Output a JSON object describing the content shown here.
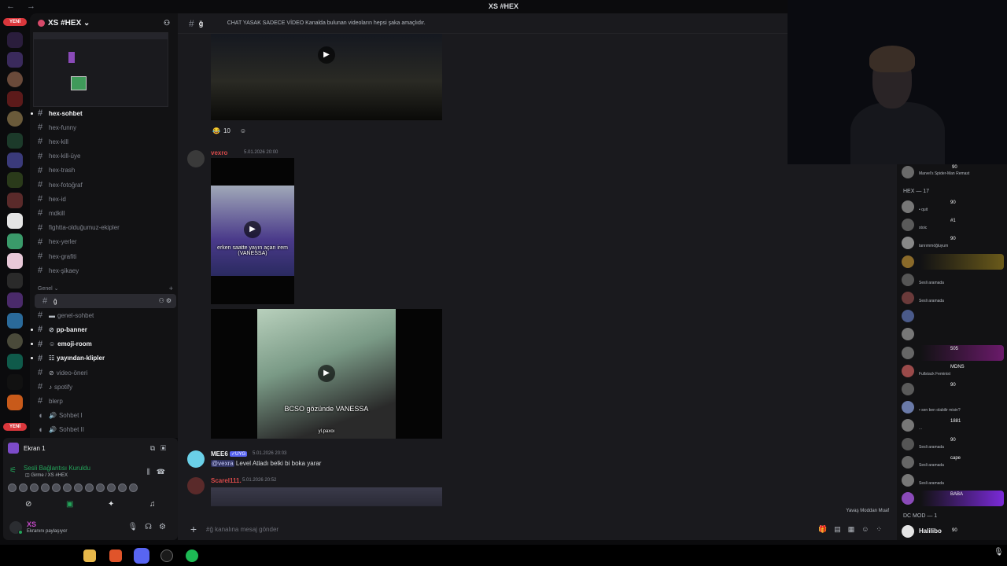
{
  "window": {
    "title": "XS #HEX",
    "nav": "← →"
  },
  "rail": {
    "new_top": "YENİ",
    "new_bottom": "YENİ"
  },
  "server": {
    "name": "XS #HEX ⌄"
  },
  "channels": [
    {
      "name": "hex-sohbet",
      "unread": true
    },
    {
      "name": "hex-funny"
    },
    {
      "name": "hex-kill"
    },
    {
      "name": "hex-kill-üye"
    },
    {
      "name": "hex-trash"
    },
    {
      "name": "hex-fotoğraf"
    },
    {
      "name": "hex-id"
    },
    {
      "name": "mdkill"
    },
    {
      "name": "fightta-olduğumuz-ekipler"
    },
    {
      "name": "hex-yerler"
    },
    {
      "name": "hex-grafiti"
    },
    {
      "name": "hex-şikaey"
    }
  ],
  "category_general": "Genel ⌄",
  "general_channels": [
    {
      "name": "ğ",
      "active": true
    },
    {
      "name": "genel-sohbet"
    },
    {
      "name": "pp-banner",
      "unread": true
    },
    {
      "name": "emoji-room",
      "unread": true
    },
    {
      "name": "yayından-klipler",
      "unread": true
    },
    {
      "name": "video-öneri"
    },
    {
      "name": "spotify"
    },
    {
      "name": "blerp"
    },
    {
      "name": "Sohbet I"
    },
    {
      "name": "Sohbet II"
    }
  ],
  "voice_panel": {
    "stream_title": "Ekran 1",
    "connected": "Sesli Bağlantısı Kuruldu",
    "connected_sub": "◫ Girme / XS #HEX"
  },
  "user": {
    "name": "XS",
    "status": "Ekranını paylaşıyor"
  },
  "channel_header": {
    "name": "ğ",
    "topic": "CHAT YASAK SADECE VİDEO Kanalda bulunan videoların hepsi şaka amaçlıdır."
  },
  "messages": {
    "reaction_count": "10",
    "vexro": {
      "name": "vexro",
      "time": "5.01.2026 20:00",
      "caption1": "erken saatte yayın açan irem (VANESSA)",
      "caption2": "BCSO gözünde VANESSA",
      "watermark": "yl.paxoı"
    },
    "mee6": {
      "name": "MEE6",
      "tag": "✓UYG",
      "time": "5.01.2026 20:03",
      "mention": "@vexra",
      "text": "Level Atladı belki bi boka yarar"
    },
    "scarel": {
      "name": "Scarel111.",
      "time": "5.01.2026 20:52"
    }
  },
  "slowmode": "Yavaş Moddan Muaf",
  "composer": {
    "placeholder": "#ğ kanalına mesaj gönder"
  },
  "members": {
    "top_activity": "Marvel's Spider-Man Remast",
    "top_badge": "90",
    "group1": "HEX — 17",
    "group2": "DC MOD — 1",
    "list": [
      {
        "name": "",
        "badge": "90",
        "activity": "• quit"
      },
      {
        "name": "",
        "badge": "#1",
        "activity": "stoic"
      },
      {
        "name": "",
        "badge": "90",
        "activity": "tanrımmöğluyum"
      },
      {
        "name": "",
        "badge": "",
        "activity": ""
      },
      {
        "name": "",
        "badge": "",
        "activity": "Sesli aramada"
      },
      {
        "name": "",
        "badge": "",
        "activity": "Sesli aramada"
      },
      {
        "name": "",
        "badge": "",
        "activity": ""
      },
      {
        "name": "",
        "badge": "",
        "activity": ""
      },
      {
        "name": "",
        "badge": "505",
        "activity": ""
      },
      {
        "name": "",
        "badge": "MDNS",
        "activity": "Fullstack Feminist"
      },
      {
        "name": "",
        "badge": "90",
        "activity": ""
      },
      {
        "name": "",
        "badge": "",
        "activity": "• sen ben olabilir misin?"
      },
      {
        "name": "",
        "badge": "1881",
        "activity": "..."
      },
      {
        "name": "",
        "badge": "90",
        "activity": "Sesli aramada"
      },
      {
        "name": "",
        "badge": "cape",
        "activity": "Sesli aramada"
      },
      {
        "name": "",
        "badge": "",
        "activity": "Sesli aramada"
      },
      {
        "name": "",
        "badge": "BABA",
        "activity": ""
      }
    ],
    "mod": {
      "name": "Halilibo",
      "badge": "90"
    }
  },
  "colors": {
    "accent": "#5865f2",
    "online": "#23a55a",
    "alert": "#da373c",
    "bg": "#1a1a1e",
    "sidebar": "#121214"
  }
}
